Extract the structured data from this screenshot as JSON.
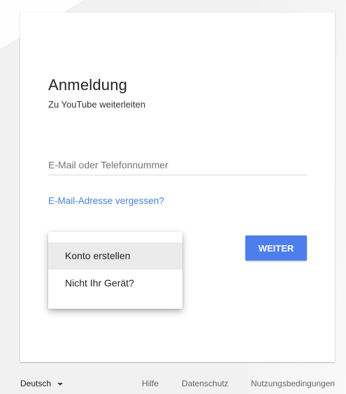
{
  "card": {
    "title": "Anmeldung",
    "subtitle": "Zu YouTube weiterleiten",
    "email_field": {
      "placeholder": "E-Mail oder Telefonnummer",
      "value": ""
    },
    "forgot_link": "E-Mail-Adresse vergessen?",
    "next_button": "WEITER",
    "menu": {
      "items": [
        {
          "label": "Konto erstellen",
          "highlighted": true
        },
        {
          "label": "Nicht Ihr Gerät?",
          "highlighted": false
        }
      ]
    }
  },
  "footer": {
    "language": "Deutsch",
    "links": {
      "help": "Hilfe",
      "privacy": "Datenschutz",
      "terms": "Nutzungsbedingungen"
    }
  },
  "colors": {
    "accent": "#4d7fec",
    "link": "#4a7fd8",
    "menu_highlight": "#ebebeb"
  },
  "icons": {
    "language_caret": "caret-down-icon"
  }
}
